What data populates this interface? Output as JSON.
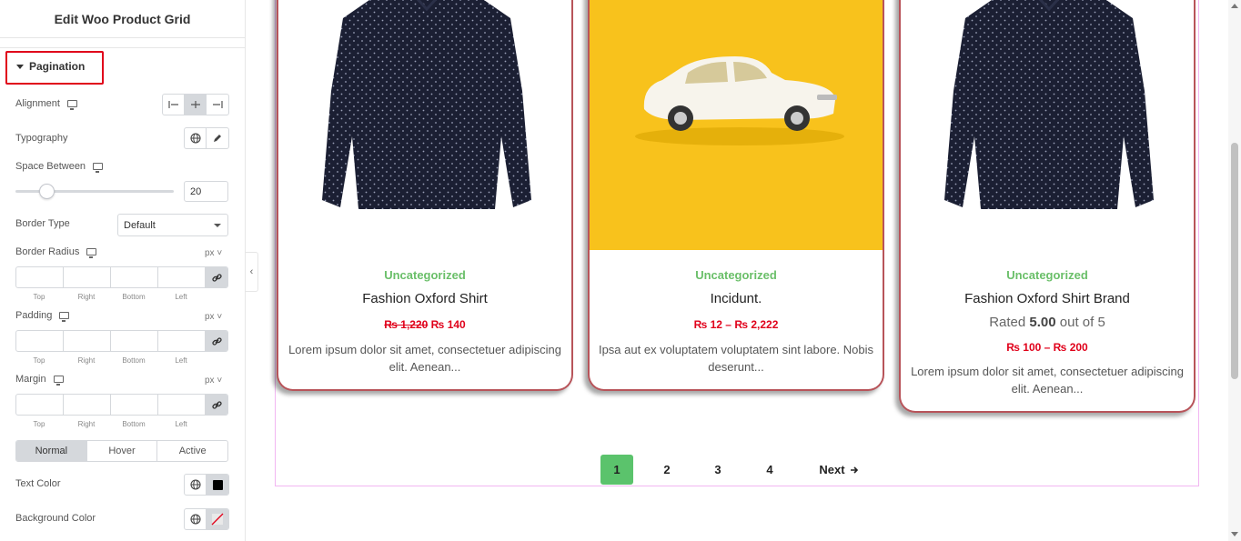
{
  "panel": {
    "title": "Edit Woo Product Grid",
    "section": "Pagination",
    "alignment": {
      "label": "Alignment",
      "options": [
        "left",
        "center",
        "right"
      ],
      "selected": "center"
    },
    "typography": {
      "label": "Typography"
    },
    "space_between": {
      "label": "Space Between",
      "value": "20",
      "slider_fraction": 0.2
    },
    "border_type": {
      "label": "Border Type",
      "value": "Default"
    },
    "border_radius": {
      "label": "Border Radius",
      "unit": "px"
    },
    "padding": {
      "label": "Padding",
      "unit": "px"
    },
    "margin": {
      "label": "Margin",
      "unit": "px"
    },
    "dimension_labels": [
      "Top",
      "Right",
      "Bottom",
      "Left"
    ],
    "state_tabs": [
      "Normal",
      "Hover",
      "Active"
    ],
    "active_state": "Normal",
    "text_color": {
      "label": "Text Color",
      "value": "#000000"
    },
    "background_color": {
      "label": "Background Color"
    },
    "collapse_icon": "‹"
  },
  "products": [
    {
      "image": "navy polka-dot shirt",
      "category": "Uncategorized",
      "title": "Fashion Oxford Shirt",
      "price_old": "₨ 1,220",
      "price_new": "₨ 140",
      "description": "Lorem ipsum dolor sit amet, consectetuer adipiscing elit. Aenean..."
    },
    {
      "image": "white car on yellow background",
      "category": "Uncategorized",
      "title": "Incidunt.",
      "price_range": "₨ 12 – ₨ 2,222",
      "description": "Ipsa aut ex voluptatem voluptatem sint labore. Nobis deserunt..."
    },
    {
      "image": "navy polka-dot shirt",
      "category": "Uncategorized",
      "title": "Fashion Oxford Shirt Brand",
      "rating_prefix": "Rated",
      "rating_value": "5.00",
      "rating_suffix": "out of 5",
      "price_range": "₨ 100 – ₨ 200",
      "description": "Lorem ipsum dolor sit amet, consectetuer adipiscing elit. Aenean..."
    }
  ],
  "pagination": {
    "pages": [
      "1",
      "2",
      "3",
      "4"
    ],
    "current": "1",
    "next_label": "Next",
    "active_color": "#5bc36c"
  },
  "colors": {
    "card_border": "#b8545a",
    "category": "#6abf69",
    "price": "#e0001a",
    "highlight": "#e0001a",
    "grid_frame": "#f2b6f2"
  }
}
